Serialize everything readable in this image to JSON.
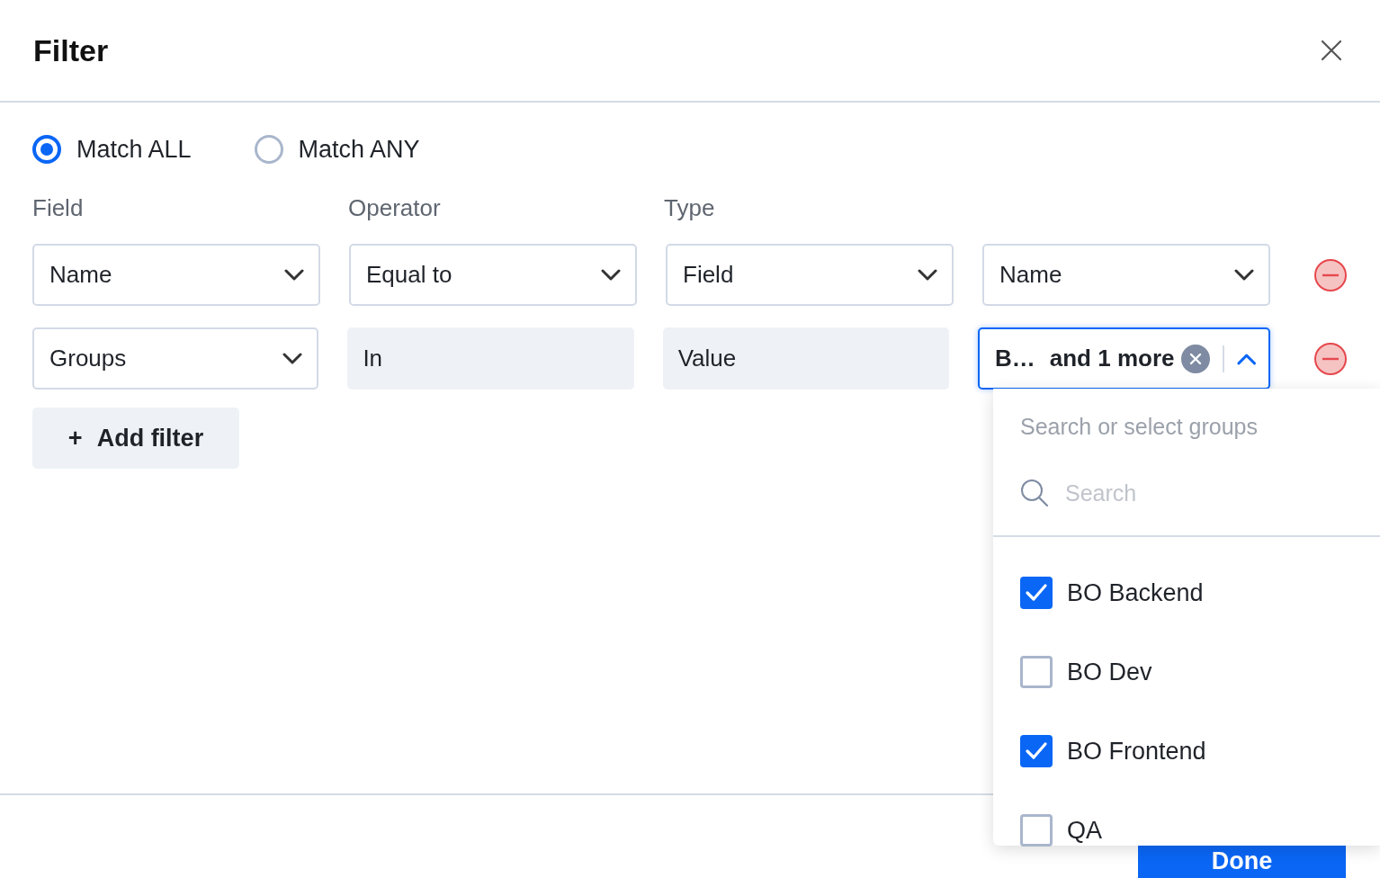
{
  "dialog": {
    "title": "Filter"
  },
  "match_options": [
    {
      "label": "Match ALL",
      "selected": true
    },
    {
      "label": "Match ANY",
      "selected": false
    }
  ],
  "columns": [
    "Field",
    "Operator",
    "Type"
  ],
  "rows": [
    {
      "cells": [
        {
          "kind": "select",
          "value": "Name"
        },
        {
          "kind": "select",
          "value": "Equal to"
        },
        {
          "kind": "select",
          "value": "Field"
        },
        {
          "kind": "select",
          "value": "Name"
        }
      ]
    },
    {
      "cells": [
        {
          "kind": "select",
          "value": "Groups"
        },
        {
          "kind": "static",
          "value": "In"
        },
        {
          "kind": "static",
          "value": "Value"
        },
        {
          "kind": "multi",
          "chip": "B…",
          "more": "and 1 more",
          "expanded": true
        }
      ]
    }
  ],
  "add_button": {
    "label": "Add filter",
    "icon": "+"
  },
  "dropdown": {
    "heading": "Search or select groups",
    "search_placeholder": "Search",
    "options": [
      {
        "label": "BO Backend",
        "checked": true
      },
      {
        "label": "BO Dev",
        "checked": false
      },
      {
        "label": "BO Frontend",
        "checked": true
      },
      {
        "label": "QA",
        "checked": false
      }
    ]
  },
  "footer": {
    "button": "Done"
  }
}
